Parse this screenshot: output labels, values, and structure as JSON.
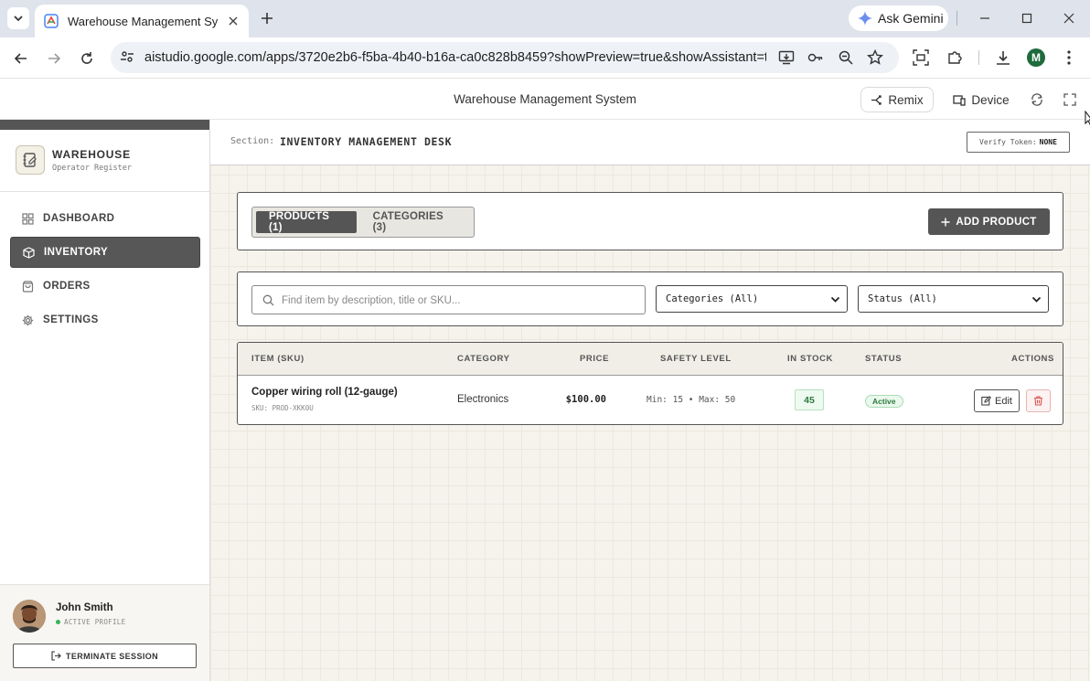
{
  "browser": {
    "tab_title": "Warehouse Management System",
    "url": "aistudio.google.com/apps/3720e2b6-f5ba-4b40-b16a-ca0c828b8459?showPreview=true&showAssistant=tr...",
    "gemini_label": "Ask Gemini",
    "profile_initial": "M"
  },
  "studio": {
    "title": "Warehouse Management System",
    "remix_label": "Remix",
    "device_label": "Device"
  },
  "sidebar": {
    "brand_name": "WAREHOUSE",
    "brand_sub": "Operator Register",
    "items": [
      {
        "label": "DASHBOARD",
        "icon": "grid-icon"
      },
      {
        "label": "INVENTORY",
        "icon": "box-icon"
      },
      {
        "label": "ORDERS",
        "icon": "bag-icon"
      },
      {
        "label": "SETTINGS",
        "icon": "gear-icon"
      }
    ],
    "active": "INVENTORY",
    "user_name": "John Smith",
    "user_status": "ACTIVE PROFILE",
    "terminate_label": "TERMINATE SESSION"
  },
  "header": {
    "section_label": "Section:",
    "section_value": "INVENTORY MANAGEMENT DESK",
    "verify_label": "Verify Token:",
    "verify_value": "NONE"
  },
  "tabs": {
    "products": "PRODUCTS (1)",
    "categories": "CATEGORIES (3)"
  },
  "add_product_label": "ADD PRODUCT",
  "filters": {
    "search_placeholder": "Find item by description, title or SKU...",
    "category_value": "Categories (All)",
    "status_value": "Status (All)"
  },
  "table": {
    "columns": [
      "ITEM (SKU)",
      "CATEGORY",
      "PRICE",
      "SAFETY LEVEL",
      "IN STOCK",
      "STATUS",
      "ACTIONS"
    ],
    "rows": [
      {
        "name": "Copper wiring roll (12-gauge)",
        "sku": "SKU: PROD-XKK0U",
        "category": "Electronics",
        "price": "$100.00",
        "safety": "Min: 15 • Max: 50",
        "stock": "45",
        "status": "Active",
        "edit_label": "Edit"
      }
    ]
  },
  "colors": {
    "accent_dark": "#555555",
    "status_green": "#2c7a3d",
    "delete_red": "#d9534f"
  }
}
